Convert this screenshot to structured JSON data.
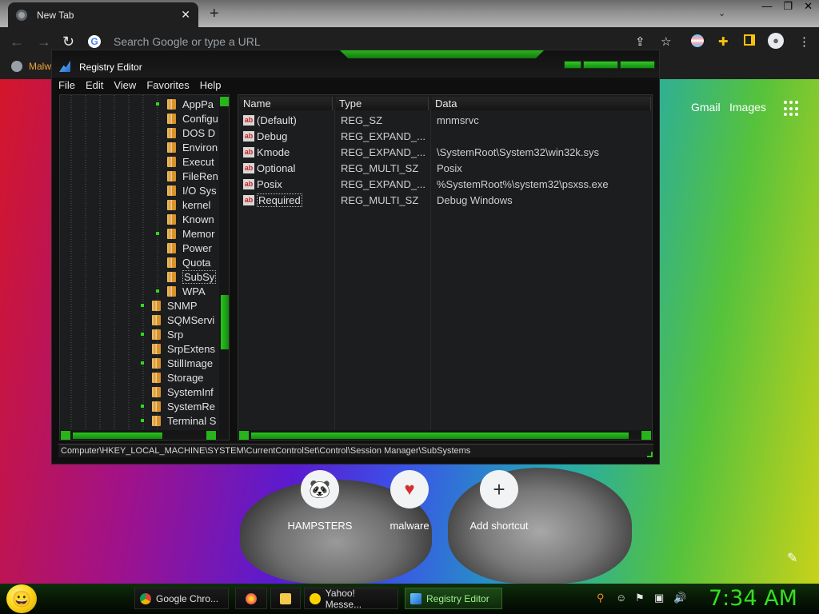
{
  "browser": {
    "tab_title": "New Tab",
    "tab_close": "✕",
    "new_tab": "+",
    "omnibox_placeholder": "Search Google or type a URL",
    "bookmark_label": "Malw"
  },
  "ntp": {
    "links": [
      "Gmail",
      "Images"
    ],
    "shortcuts": [
      {
        "label": "HAMPSTERS",
        "icon": "🐼"
      },
      {
        "label": "malware",
        "icon": "♥"
      },
      {
        "label": "Add shortcut",
        "icon": "+"
      }
    ]
  },
  "regedit": {
    "title": "Registry Editor",
    "menu": [
      "File",
      "Edit",
      "View",
      "Favorites",
      "Help"
    ],
    "tree": [
      {
        "label": "AppPa",
        "depth": 2,
        "expander": true
      },
      {
        "label": "Configu",
        "depth": 2,
        "expander": false
      },
      {
        "label": "DOS D",
        "depth": 2,
        "expander": false
      },
      {
        "label": "Environ",
        "depth": 2,
        "expander": false
      },
      {
        "label": "Execut",
        "depth": 2,
        "expander": false
      },
      {
        "label": "FileRen",
        "depth": 2,
        "expander": false
      },
      {
        "label": "I/O Sys",
        "depth": 2,
        "expander": false
      },
      {
        "label": "kernel",
        "depth": 2,
        "expander": false
      },
      {
        "label": "Known",
        "depth": 2,
        "expander": false
      },
      {
        "label": "Memor",
        "depth": 2,
        "expander": true
      },
      {
        "label": "Power",
        "depth": 2,
        "expander": false
      },
      {
        "label": "Quota",
        "depth": 2,
        "expander": false
      },
      {
        "label": "SubSy",
        "depth": 2,
        "expander": false,
        "selected": true
      },
      {
        "label": "WPA",
        "depth": 2,
        "expander": true
      },
      {
        "label": "SNMP",
        "depth": 1,
        "expander": true
      },
      {
        "label": "SQMServi",
        "depth": 1,
        "expander": false
      },
      {
        "label": "Srp",
        "depth": 1,
        "expander": true
      },
      {
        "label": "SrpExtens",
        "depth": 1,
        "expander": false
      },
      {
        "label": "StillImage",
        "depth": 1,
        "expander": true
      },
      {
        "label": "Storage",
        "depth": 1,
        "expander": false
      },
      {
        "label": "SystemInf",
        "depth": 1,
        "expander": false
      },
      {
        "label": "SystemRe",
        "depth": 1,
        "expander": true
      },
      {
        "label": "Terminal S",
        "depth": 1,
        "expander": true
      }
    ],
    "columns": [
      "Name",
      "Type",
      "Data"
    ],
    "values": [
      {
        "name": "(Default)",
        "type": "REG_SZ",
        "data": "mnmsrvc"
      },
      {
        "name": "Debug",
        "type": "REG_EXPAND_...",
        "data": ""
      },
      {
        "name": "Kmode",
        "type": "REG_EXPAND_...",
        "data": "\\SystemRoot\\System32\\win32k.sys"
      },
      {
        "name": "Optional",
        "type": "REG_MULTI_SZ",
        "data": "Posix"
      },
      {
        "name": "Posix",
        "type": "REG_EXPAND_...",
        "data": "%SystemRoot%\\system32\\psxss.exe"
      },
      {
        "name": "Required",
        "type": "REG_MULTI_SZ",
        "data": "Debug Windows"
      }
    ],
    "status_path": "Computer\\HKEY_LOCAL_MACHINE\\SYSTEM\\CurrentControlSet\\Control\\Session Manager\\SubSystems"
  },
  "taskbar": {
    "items": [
      {
        "label": "Google Chro...",
        "icon": "chrome-icon",
        "active": false
      },
      {
        "label": "",
        "icon": "firefox-icon",
        "active": false
      },
      {
        "label": "",
        "icon": "folder-icon",
        "active": false
      },
      {
        "label": "Yahoo! Messe...",
        "icon": "messenger-icon",
        "active": false
      },
      {
        "label": "Registry Editor",
        "icon": "regedit-icon",
        "active": true
      }
    ],
    "clock": "7:34 AM"
  },
  "colors": {
    "accent": "#2bc41e",
    "clock": "#33e01f"
  }
}
